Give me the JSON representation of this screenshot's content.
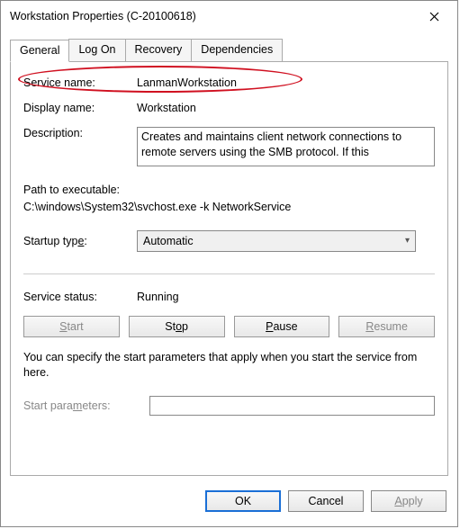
{
  "titlebar": {
    "title": "Workstation Properties (C-20100618)"
  },
  "tabs": {
    "general": "General",
    "logon": "Log On",
    "recovery": "Recovery",
    "dependencies": "Dependencies"
  },
  "general": {
    "service_name_label": "Service name:",
    "service_name_value": "LanmanWorkstation",
    "display_name_label": "Display name:",
    "display_name_value": "Workstation",
    "description_label": "Description:",
    "description_value": "Creates and maintains client network connections to remote servers using the SMB protocol. If this",
    "path_label": "Path to executable:",
    "path_value": "C:\\windows\\System32\\svchost.exe -k NetworkService",
    "startup_prefix": "Startup typ",
    "startup_ul": "e",
    "startup_suffix": ":",
    "startup_value": "Automatic",
    "status_label": "Service status:",
    "status_value": "Running",
    "start_ul": "S",
    "start_rest": "tart",
    "stop_pre": "St",
    "stop_ul": "o",
    "stop_post": "p",
    "pause_ul": "P",
    "pause_rest": "ause",
    "resume_ul": "R",
    "resume_rest": "esume",
    "hint_text": "You can specify the start parameters that apply when you start the service from here.",
    "params_pre": "Start para",
    "params_ul": "m",
    "params_post": "eters:"
  },
  "footer": {
    "ok": "OK",
    "cancel": "Cancel",
    "apply_ul": "A",
    "apply_rest": "pply"
  }
}
